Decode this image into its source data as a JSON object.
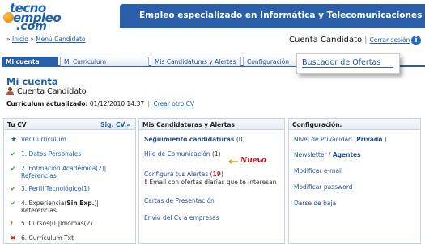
{
  "logo": {
    "line1": "tecno",
    "line2": "empleo",
    "line3": ".com"
  },
  "banner": {
    "title": "Empleo especializado en Informática y Telecomunicaciones"
  },
  "breadcrumb": {
    "prefix": "» ",
    "home": "Inicio",
    "separator": " » ",
    "current": "Menú Candidato"
  },
  "account": {
    "label": "Cuenta Candidato",
    "separator": "|",
    "logout": "Cerrar sesión"
  },
  "tabs": [
    {
      "label": "Mi cuenta",
      "active": true
    },
    {
      "label": "Mi Currículum",
      "active": false
    },
    {
      "label": "Mis Candidaturas y Alertas",
      "active": false
    },
    {
      "label": "Configuración",
      "active": false
    },
    {
      "label": "Buscador de Ofertas",
      "active": false
    }
  ],
  "main": {
    "title": "Mi cuenta",
    "user_name": "Cuenta Candidato",
    "cv_updated_label": "Currículum actualizado:",
    "cv_updated_value": "01/12/2010 14:37",
    "cv_separator": "|",
    "create_cv_link": "Crear otro CV"
  },
  "cv_panel": {
    "title": "Tu CV",
    "view_link": "Sig. CV.»",
    "items": [
      {
        "icon": "star-icon",
        "text": "Ver Currículum"
      },
      {
        "icon": "check-icon",
        "text": "1.  Datos Personales"
      },
      {
        "icon": "check-icon",
        "text": "2.  Formación Académica(2)|",
        "line2": "Referencias"
      },
      {
        "icon": "check-icon",
        "text": "3.  Perfil Tecnológico(1)"
      },
      {
        "icon": "check-icon",
        "text": "4.  Experiencia(",
        "bold": "Sin Exp.",
        "text_after": ")|",
        "line2": "Referencias"
      },
      {
        "icon": "warning-icon",
        "text": "5.  Cursos(0)|Idiomas(2)"
      },
      {
        "icon": "cross-icon",
        "text": "6.  Currículum Txt"
      }
    ]
  },
  "candidaturas_panel": {
    "title": "Mis Candidaturas y Alertas",
    "items": [
      {
        "label": "Seguimiento candidaturas",
        "count": "(0)"
      },
      {
        "label": "Hilo de Comunicación",
        "count": "(1)"
      },
      {
        "label": "Configura tus Alertas",
        "count_open": " (",
        "count_value": "19",
        "count_close": ")"
      },
      {
        "label": "Cartas de Presentación"
      },
      {
        "label": "Envio del Cv a empresas"
      }
    ],
    "alert_note": "Email con ofertas diarias que te interesan",
    "new_badge": "Nuevo"
  },
  "config_panel": {
    "title": "Configuración.",
    "items": [
      {
        "label": "Nivel de Privacidad (",
        "bold": "Privado",
        "after": " )"
      },
      {
        "label": "Newsletter",
        "sep": " / ",
        "bold": "Agentes"
      },
      {
        "label": "Modificar e-mail"
      },
      {
        "label": "Modificar password"
      },
      {
        "label": "Darse de baja"
      }
    ]
  },
  "colors": {
    "brand": "#2a5ea8",
    "link": "#1f5fa8",
    "alert": "#c62a2a",
    "success": "#2a9a2a"
  }
}
